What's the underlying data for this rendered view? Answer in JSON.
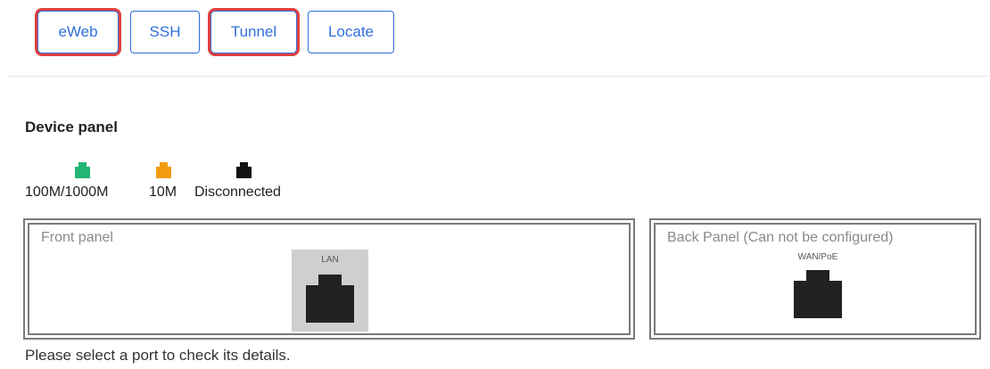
{
  "toolbar": {
    "eweb_label": "eWeb",
    "ssh_label": "SSH",
    "tunnel_label": "Tunnel",
    "locate_label": "Locate",
    "accent_color": "#2f6fde",
    "highlight_color": "#e14040"
  },
  "device_panel": {
    "title": "Device panel",
    "legend": [
      {
        "label": "100M/1000M",
        "color": "#22b573",
        "icon": "port-green-icon"
      },
      {
        "label": "10M",
        "color": "#f39c12",
        "icon": "port-orange-icon"
      },
      {
        "label": "Disconnected",
        "color": "#111111",
        "icon": "port-black-icon"
      }
    ],
    "front_panel": {
      "title": "Front panel",
      "ports": [
        {
          "label": "LAN"
        }
      ]
    },
    "back_panel": {
      "title": "Back Panel (Can not be configured)",
      "ports": [
        {
          "label": "WAN/PoE"
        }
      ]
    },
    "hint": "Please select a port to check its details."
  }
}
